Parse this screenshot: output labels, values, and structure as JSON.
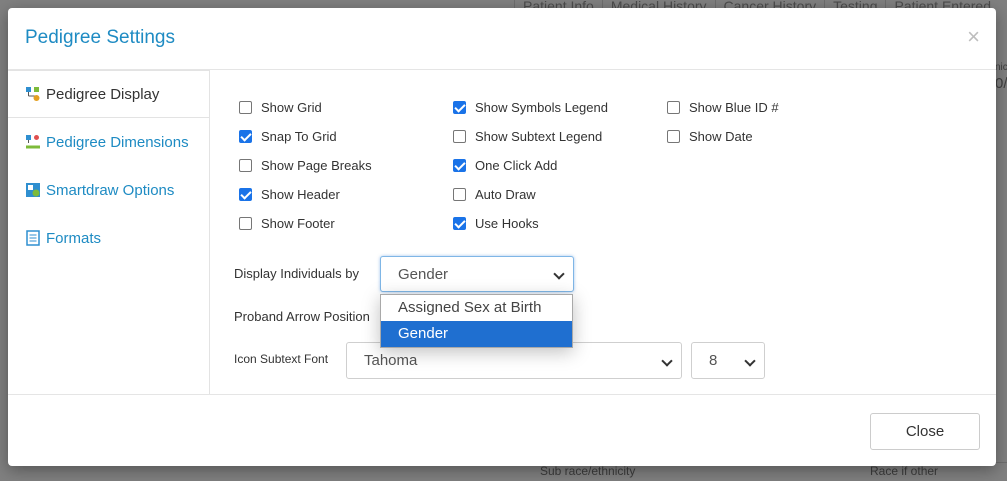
{
  "background": {
    "tabs": [
      "Patient Info",
      "Medical History",
      "Cancer History",
      "Testing",
      "Patient Entered"
    ],
    "bottom_labels": [
      "Sub race/ethnicity",
      "Race if other"
    ],
    "side_text": [
      "nic",
      "0/"
    ]
  },
  "modal": {
    "title": "Pedigree Settings",
    "close_symbol": "×",
    "sidebar": [
      {
        "label": "Pedigree Display",
        "icon": "pedigree-display-icon",
        "active": true
      },
      {
        "label": "Pedigree Dimensions",
        "icon": "pedigree-dimensions-icon",
        "active": false
      },
      {
        "label": "Smartdraw Options",
        "icon": "smartdraw-options-icon",
        "active": false
      },
      {
        "label": "Formats",
        "icon": "formats-icon",
        "active": false
      }
    ],
    "checkboxes": {
      "col1": [
        {
          "label": "Show Grid",
          "checked": false
        },
        {
          "label": "Snap To Grid",
          "checked": true
        },
        {
          "label": "Show Page Breaks",
          "checked": false
        },
        {
          "label": "Show Header",
          "checked": true
        },
        {
          "label": "Show Footer",
          "checked": false
        }
      ],
      "col2": [
        {
          "label": "Show Symbols Legend",
          "checked": true
        },
        {
          "label": "Show Subtext Legend",
          "checked": false
        },
        {
          "label": "One Click Add",
          "checked": true
        },
        {
          "label": "Auto Draw",
          "checked": false
        },
        {
          "label": "Use Hooks",
          "checked": true
        }
      ],
      "col3": [
        {
          "label": "Show Blue ID #",
          "checked": false
        },
        {
          "label": "Show Date",
          "checked": false
        }
      ]
    },
    "display_individuals": {
      "label": "Display Individuals by",
      "value": "Gender",
      "options": [
        "Assigned Sex at Birth",
        "Gender"
      ],
      "selected_index": 1
    },
    "proband_arrow": {
      "label": "Proband Arrow Position"
    },
    "icon_subtext": {
      "label": "Icon Subtext Font",
      "font_value": "Tahoma",
      "size_value": "8"
    },
    "footer": {
      "close_label": "Close"
    }
  },
  "colors": {
    "accent": "#1e8bc3",
    "checkbox": "#1a73e8",
    "highlight": "#1f6fd0"
  }
}
